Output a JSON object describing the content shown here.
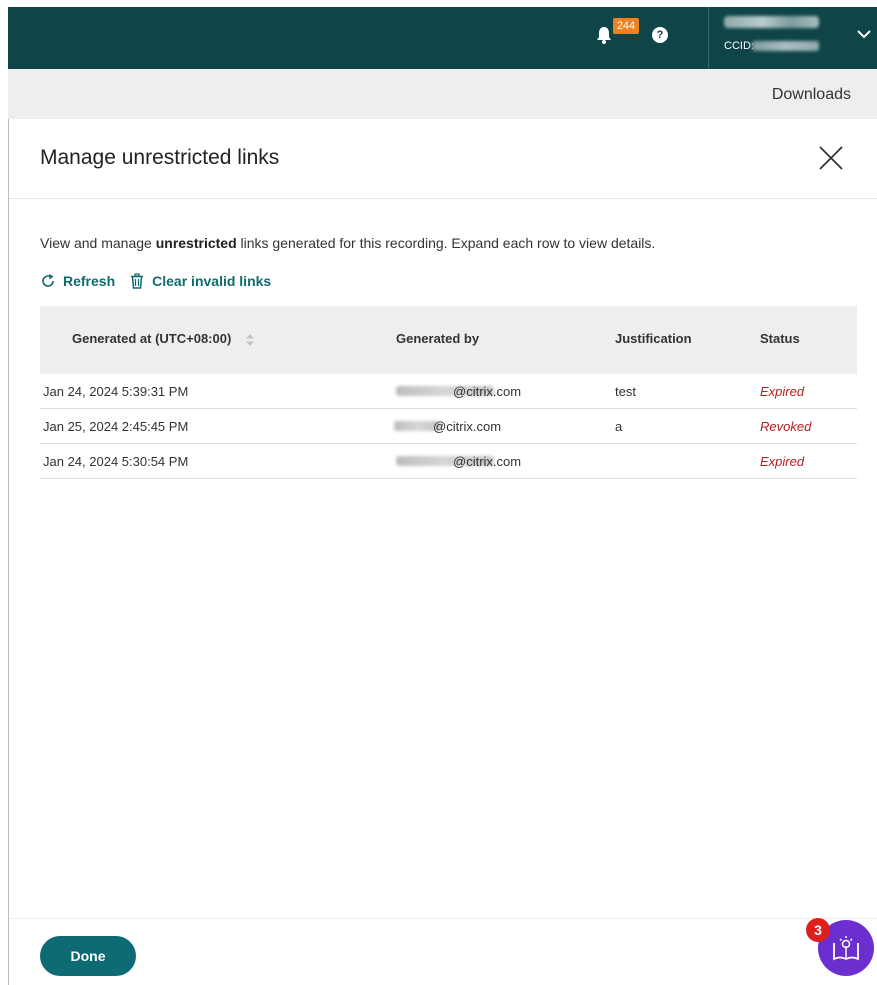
{
  "header": {
    "notification_count": "244",
    "help_glyph": "?",
    "ccid_label": "CCID:"
  },
  "subbar": {
    "downloads_label": "Downloads"
  },
  "dialog": {
    "title": "Manage unrestricted links",
    "description_prefix": "View and manage ",
    "description_bold": "unrestricted",
    "description_suffix": " links generated for this recording. Expand each row to view details.",
    "refresh_label": "Refresh",
    "clear_label": "Clear invalid links",
    "done_label": "Done"
  },
  "table": {
    "headers": {
      "generated_at": "Generated at (UTC+08:00)",
      "generated_by": "Generated by",
      "justification": "Justification",
      "status": "Status"
    },
    "rows": [
      {
        "generated_at": "Jan 24, 2024 5:39:31 PM",
        "generated_by": "@citrix.com",
        "justification": "test",
        "status": "Expired"
      },
      {
        "generated_at": "Jan 25, 2024 2:45:45 PM",
        "generated_by": "@citrix.com",
        "justification": "a",
        "status": "Revoked"
      },
      {
        "generated_at": "Jan 24, 2024 5:30:54 PM",
        "generated_by": "@citrix.com",
        "justification": "",
        "status": "Expired"
      }
    ]
  },
  "help_fab": {
    "badge_count": "3"
  },
  "colors": {
    "topbar": "#0f4548",
    "accent": "#0f6b73",
    "status_red": "#b22222",
    "badge_orange": "#f0811f",
    "fab_purple": "#6b2fd0"
  },
  "icons": [
    "bell-icon",
    "help-icon",
    "chevron-down-icon",
    "close-icon",
    "refresh-icon",
    "trash-icon",
    "sort-icon",
    "guide-icon"
  ]
}
